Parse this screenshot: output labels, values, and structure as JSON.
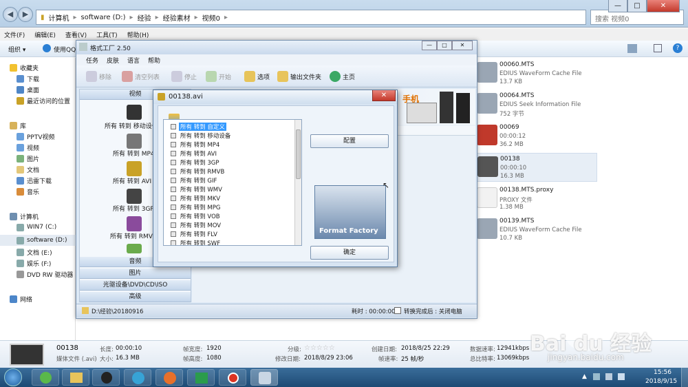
{
  "explorer": {
    "breadcrumb": [
      "计算机",
      "software (D:)",
      "经验",
      "经验素材",
      "视频0"
    ],
    "search_placeholder": "搜索 视频0",
    "menu": [
      "文件(F)",
      "编辑(E)",
      "查看(V)",
      "工具(T)",
      "帮助(H)"
    ],
    "toolbar": {
      "organize": "组织 ▾",
      "use_qq": "使用QQ"
    },
    "nav": {
      "favorites_header": "收藏夹",
      "favorites": [
        "下载",
        "桌面",
        "最近访问的位置"
      ],
      "library_header": "库",
      "library": [
        "PPTV视频",
        "视频",
        "图片",
        "文档",
        "迅雷下载",
        "音乐"
      ],
      "computer_header": "计算机",
      "drives": [
        "WIN7 (C:)",
        "software (D:)",
        "文档 (E:)",
        "娱乐 (F:)",
        "DVD RW 驱动器"
      ],
      "network": "网络"
    },
    "files": [
      {
        "name": "00060.MTS",
        "type": "EDIUS WaveForm Cache File",
        "size": "13.7 KB"
      },
      {
        "name": "00064.MTS",
        "type": "EDIUS Seek Information File",
        "size": "752 字节"
      },
      {
        "name": "00069",
        "type": "00:00:12",
        "size": "36.2 MB"
      },
      {
        "name": "00138",
        "type": "00:00:10",
        "size": "16.3 MB"
      },
      {
        "name": "00138.MTS.proxy",
        "type": "PROXY 文件",
        "size": "1.38 MB"
      },
      {
        "name": "00139.MTS",
        "type": "EDIUS WaveForm Cache File",
        "size": "10.7 KB"
      }
    ],
    "details": {
      "file_name": "00138",
      "file_type": "媒体文件 (.avi)",
      "length_label": "长度:",
      "length_value": "00:00:10",
      "size_label": "大小:",
      "size_value": "16.3 MB",
      "width_label": "帧宽度:",
      "width_value": "1920",
      "height_label": "帧高度:",
      "height_value": "1080",
      "rating_label": "分级:",
      "modified_label": "修改日期:",
      "modified_value": "2018/8/29 23:06",
      "created_label": "创建日期:",
      "created_value": "2018/8/25 22:29",
      "fps_label": "帧速率:",
      "fps_value": "25 帧/秒",
      "datarate_label": "数据速率:",
      "datarate_value": "12941kbps",
      "bitrate_label": "总比特率:",
      "bitrate_value": "13069kbps"
    }
  },
  "format_factory": {
    "title": "格式工厂 2.50",
    "menu": [
      "任务",
      "皮肤",
      "语言",
      "帮助"
    ],
    "tools": [
      "移除",
      "清空列表",
      "停止",
      "开始",
      "选项",
      "输出文件夹",
      "主页"
    ],
    "categories": {
      "video": "视频",
      "audio": "音频",
      "image": "图片",
      "disc": "光驱设备\\DVD\\CD\\ISO",
      "advanced": "高级"
    },
    "conversions": [
      "所有 转到 移动设备",
      "所有 转到 MP4",
      "所有 转到 AVI",
      "所有 转到 3GP",
      "所有 转到 RMVB"
    ],
    "banner_text": "手机",
    "status_path": "D:\\经验\\20180916",
    "status_elapsed": "耗时 : 00:00:00",
    "status_after": "转换完成后 : 关闭电脑"
  },
  "dialog": {
    "title": "00138.avi",
    "close": "✕",
    "options": [
      "所有 转到 自定义",
      "所有 转到 移动设备",
      "所有 转到 MP4",
      "所有 转到 AVI",
      "所有 转到 3GP",
      "所有 转到 RMVB",
      "所有 转到 GIF",
      "所有 转到 WMV",
      "所有 转到 MKV",
      "所有 转到 MPG",
      "所有 转到 VOB",
      "所有 转到 MOV",
      "所有 转到 FLV",
      "所有 转到 SWF"
    ],
    "config_button": "配置",
    "ok_button": "确定",
    "logo_text": "Format Factory"
  },
  "taskbar": {
    "time": "15:56",
    "date": "2018/9/15"
  },
  "watermark": {
    "brand": "Bai du 经验",
    "url": "jingyan.baidu.com"
  }
}
